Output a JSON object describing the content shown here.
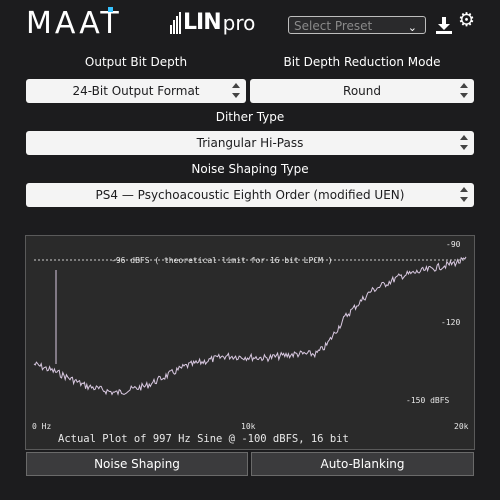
{
  "header": {
    "brand": "MAAT",
    "product_lin": "LIN",
    "product_pro": "pro",
    "preset_placeholder": "Select Preset",
    "icons": [
      "download-icon",
      "gear-icon",
      "chevron-down-icon"
    ],
    "accent_color": "#36c2ff"
  },
  "controls": {
    "output_bit_depth_label": "Output Bit Depth",
    "output_bit_depth_value": "24-Bit Output Format",
    "reduction_mode_label": "Bit Depth Reduction Mode",
    "reduction_mode_value": "Round",
    "dither_type_label": "Dither Type",
    "dither_type_value": "Triangular Hi-Pass",
    "noise_shaping_label": "Noise Shaping Type",
    "noise_shaping_value": "PS4 — Psychoacoustic Eighth Order (modified UEN)"
  },
  "graph": {
    "annotation": "-96 dBFS ( theoretical limit for 16 bit LPCM )",
    "caption": "Actual Plot of 997 Hz Sine @ -100 dBFS, 16 bit",
    "y_labels": [
      "-90",
      "-120",
      "-150 dBFS"
    ],
    "x_labels": [
      "0 Hz",
      "10k",
      "20k"
    ],
    "plot_color": "#d8c8e0"
  },
  "buttons": {
    "noise_shaping": "Noise Shaping",
    "auto_blanking": "Auto-Blanking"
  }
}
